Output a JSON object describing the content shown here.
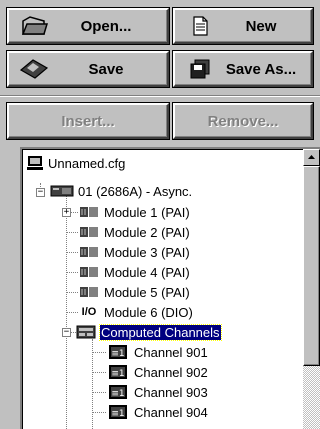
{
  "toolbar": {
    "open_label": "Open...",
    "new_label": "New",
    "save_label": "Save",
    "save_as_label": "Save As...",
    "insert_label": "Insert...",
    "remove_label": "Remove..."
  },
  "tree": {
    "root": "Unnamed.cfg",
    "device": "01 (2686A) - Async.",
    "modules": [
      "Module 1 (PAI)",
      "Module 2 (PAI)",
      "Module 3 (PAI)",
      "Module 4 (PAI)",
      "Module 5 (PAI)",
      "Module 6 (DIO)"
    ],
    "io_glyph": "I/O",
    "computed": "Computed Channels",
    "channels": [
      "Channel 901",
      "Channel 902",
      "Channel 903",
      "Channel 904"
    ]
  },
  "colors": {
    "face": "#c0c0c0",
    "selection": "#000080",
    "disabled_text": "#808080"
  }
}
